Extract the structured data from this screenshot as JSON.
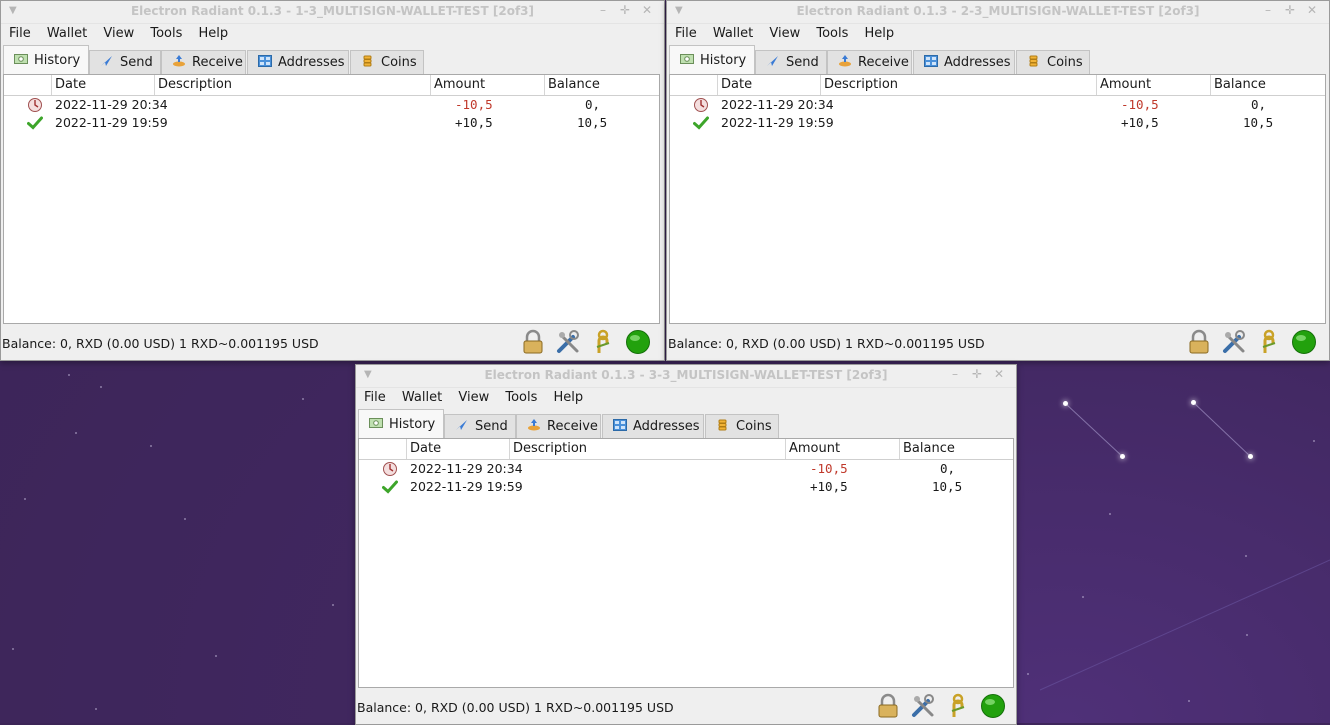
{
  "app": {
    "name": "Electron Radiant 0.1.3"
  },
  "windows": [
    {
      "title": "Electron Radiant 0.1.3  -  1-3_MULTISIGN-WALLET-TEST  [2of3]"
    },
    {
      "title": "Electron Radiant 0.1.3  -  2-3_MULTISIGN-WALLET-TEST  [2of3]"
    },
    {
      "title": "Electron Radiant 0.1.3  -  3-3_MULTISIGN-WALLET-TEST  [2of3]"
    }
  ],
  "menu": {
    "file": "File",
    "wallet": "Wallet",
    "view": "View",
    "tools": "Tools",
    "help": "Help"
  },
  "tabs": {
    "history": "History",
    "send": "Send",
    "receive": "Receive",
    "addresses": "Addresses",
    "coins": "Coins"
  },
  "table": {
    "headers": {
      "date": "Date",
      "description": "Description",
      "amount": "Amount",
      "balance": "Balance"
    },
    "rows": [
      {
        "status_icon": "unconfirmed-clock-icon",
        "date": "2022-11-29 20:34",
        "description": "",
        "amount": "-10,5",
        "balance": "0,"
      },
      {
        "status_icon": "confirmed-check-icon",
        "date": "2022-11-29 19:59",
        "description": "",
        "amount": "+10,5",
        "balance": "10,5"
      }
    ]
  },
  "status": {
    "text": "Balance: 0, RXD (0.00 USD) 1 RXD~0.001195 USD"
  },
  "status_icons": [
    "lock-icon",
    "tools-icon",
    "seed-icon",
    "network-status-icon"
  ],
  "colors": {
    "negative_amount": "#c0392b",
    "network_ok": "#22a10d",
    "desktop_bg": "#40275f"
  }
}
